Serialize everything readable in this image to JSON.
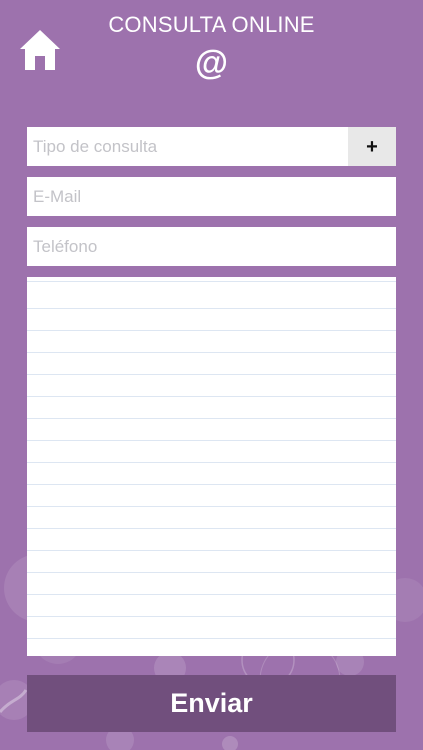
{
  "header": {
    "title": "CONSULTA ONLINE",
    "subtitle_symbol": "@",
    "home_icon": "home-icon"
  },
  "form": {
    "tipo_placeholder": "Tipo de consulta",
    "tipo_add_label": "+",
    "email_placeholder": "E-Mail",
    "telefono_placeholder": "Teléfono",
    "message_placeholder": "",
    "send_label": "Enviar"
  },
  "colors": {
    "background": "#9d72ad",
    "button": "#714f7d",
    "field": "#ffffff",
    "plus_button": "#e8e8e8"
  }
}
